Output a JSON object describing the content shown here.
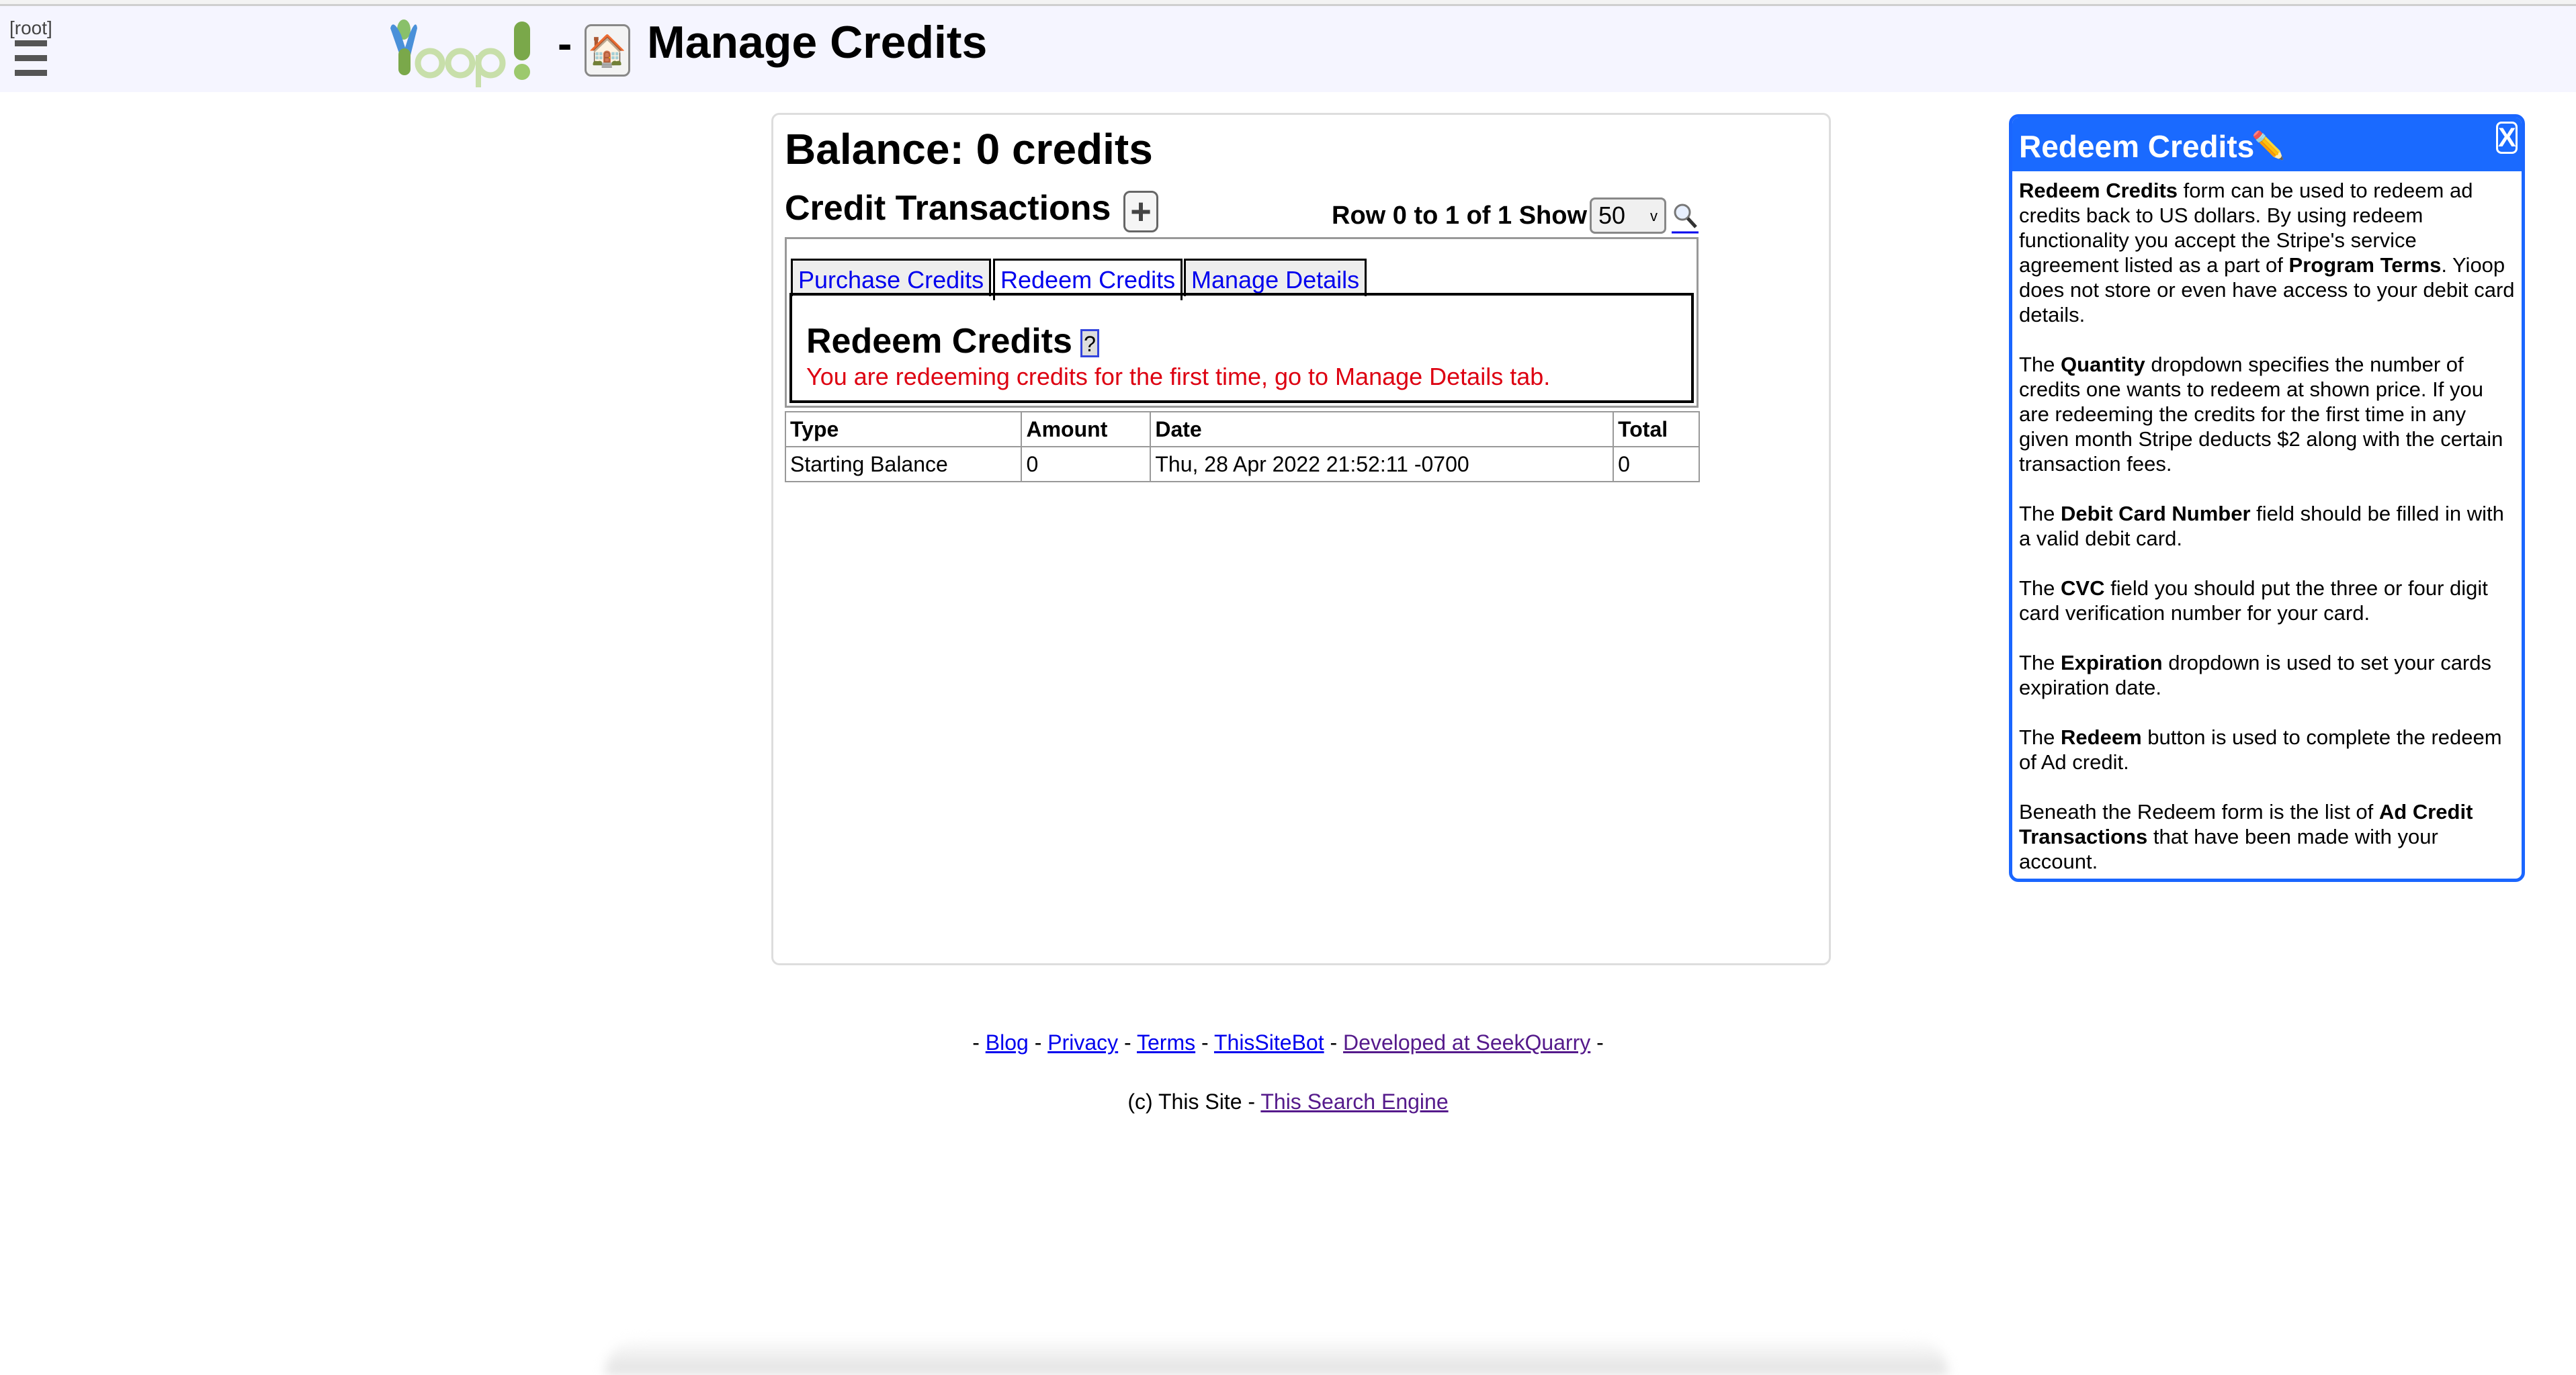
{
  "header": {
    "root_label": "[root]",
    "separator": "-",
    "title": "Manage Credits",
    "logo_alt": "Yioop!",
    "home_icon": "house-emoji"
  },
  "main": {
    "balance": "Balance: 0 credits",
    "transactions_title": "Credit Transactions",
    "add_label": "+",
    "row_info": "Row 0 to 1 of 1 Show",
    "show_value": "50",
    "tabs": [
      {
        "label": "Purchase Credits",
        "active": false
      },
      {
        "label": "Redeem Credits",
        "active": true
      },
      {
        "label": "Manage Details",
        "active": false
      }
    ],
    "panel_title": "Redeem Credits",
    "help_button": "?",
    "warning": "You are redeeming credits for the first time, go to Manage Details tab.",
    "table": {
      "headers": [
        "Type",
        "Amount",
        "Date",
        "Total"
      ],
      "rows": [
        [
          "Starting Balance",
          "0",
          "Thu, 28 Apr 2022 21:52:11 -0700",
          "0"
        ]
      ]
    }
  },
  "help": {
    "title": "Redeem Credits",
    "close": "X",
    "paragraphs": [
      [
        {
          "b": "Redeem Credits"
        },
        {
          "t": " form can be used to redeem ad credits back to US dollars. By using redeem functionality you accept the Stripe's service agreement listed as a part of "
        },
        {
          "b": "Program Terms"
        },
        {
          "t": ". Yioop does not store or even have access to your debit card details."
        }
      ],
      [
        {
          "t": "The "
        },
        {
          "b": "Quantity"
        },
        {
          "t": " dropdown specifies the number of credits one wants to redeem at shown price. If you are redeeming the credits for the first time in any given month Stripe deducts $2 along with the certain transaction fees."
        }
      ],
      [
        {
          "t": "The "
        },
        {
          "b": "Debit Card Number"
        },
        {
          "t": " field should be filled in with a valid debit card."
        }
      ],
      [
        {
          "t": "The "
        },
        {
          "b": "CVC"
        },
        {
          "t": " field you should put the three or four digit card verification number for your card."
        }
      ],
      [
        {
          "t": "The "
        },
        {
          "b": "Expiration"
        },
        {
          "t": " dropdown is used to set your cards expiration date."
        }
      ],
      [
        {
          "t": "The "
        },
        {
          "b": "Redeem"
        },
        {
          "t": " button is used to complete the redeem of Ad credit."
        }
      ],
      [
        {
          "t": "Beneath the Redeem form is the list of "
        },
        {
          "b": "Ad Credit Transactions"
        },
        {
          "t": " that have been made with your account."
        }
      ]
    ]
  },
  "footer": {
    "links": [
      {
        "label": "Blog",
        "visited": false
      },
      {
        "label": "Privacy",
        "visited": false
      },
      {
        "label": "Terms",
        "visited": false
      },
      {
        "label": "ThisSiteBot",
        "visited": false
      },
      {
        "label": "Developed at SeekQuarry",
        "visited": true
      }
    ],
    "copyright": "(c) This Site -",
    "engine_link": "This Search Engine"
  },
  "colors": {
    "accent": "#1a6aff",
    "link": "#0000ee",
    "visited": "#551a8b",
    "warning": "#dd0011",
    "header_bg": "#f5f5ff"
  }
}
